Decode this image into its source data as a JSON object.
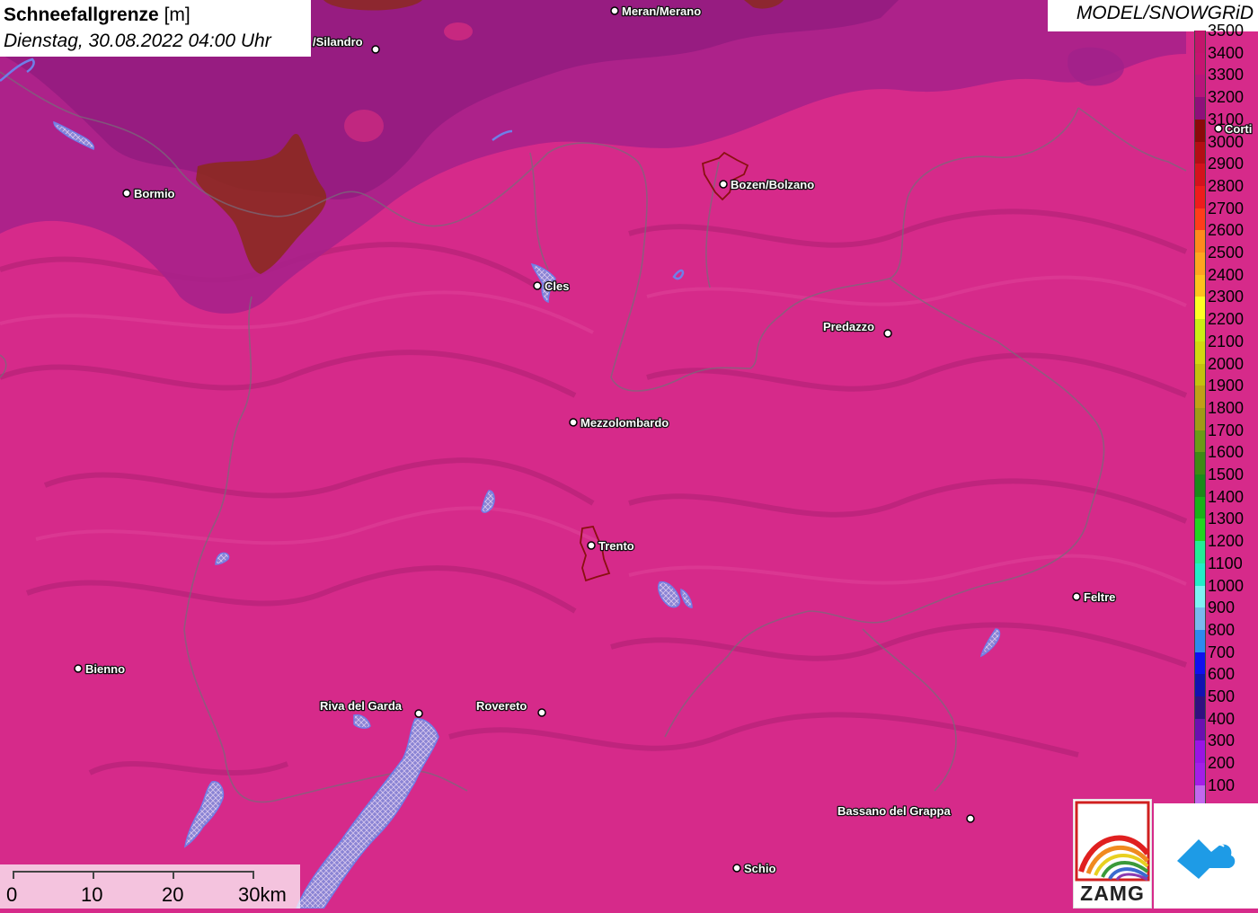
{
  "header": {
    "title_main": "Schneefallgrenze",
    "title_unit": "[m]",
    "datetime": "Dienstag, 30.08.2022 04:00 Uhr"
  },
  "model_label": "MODEL/SNOWGRiD",
  "colors": {
    "base_field": "#d62a8a",
    "lake_fill": "#8a84d4",
    "lake_outline": "#6f7fe8",
    "red_outline": "#8a1010",
    "border_line": "#7a6a7a"
  },
  "legend": [
    {
      "label": "3500",
      "color": "#c2156b"
    },
    {
      "label": "3400",
      "color": "#c51470"
    },
    {
      "label": "3300",
      "color": "#b8147a"
    },
    {
      "label": "3200",
      "color": "#8e0f7a"
    },
    {
      "label": "3100",
      "color": "#8b0a0a"
    },
    {
      "label": "3000",
      "color": "#b30e14"
    },
    {
      "label": "2900",
      "color": "#d4121c"
    },
    {
      "label": "2800",
      "color": "#ee1c1c"
    },
    {
      "label": "2700",
      "color": "#ff3d1a"
    },
    {
      "label": "2600",
      "color": "#ff8a1c"
    },
    {
      "label": "2500",
      "color": "#ffa51f"
    },
    {
      "label": "2400",
      "color": "#ffc21c"
    },
    {
      "label": "2300",
      "color": "#ffff24"
    },
    {
      "label": "2200",
      "color": "#ccee14"
    },
    {
      "label": "2100",
      "color": "#d2d810"
    },
    {
      "label": "2000",
      "color": "#c4c10e"
    },
    {
      "label": "1900",
      "color": "#c0a017"
    },
    {
      "label": "1800",
      "color": "#a09a16"
    },
    {
      "label": "1700",
      "color": "#6a9a16"
    },
    {
      "label": "1600",
      "color": "#3e8a14"
    },
    {
      "label": "1500",
      "color": "#1a8a1a"
    },
    {
      "label": "1400",
      "color": "#18b218"
    },
    {
      "label": "1300",
      "color": "#22d620"
    },
    {
      "label": "1200",
      "color": "#22ee96"
    },
    {
      "label": "1100",
      "color": "#22eec8"
    },
    {
      "label": "1000",
      "color": "#7ef2f4"
    },
    {
      "label": "900",
      "color": "#7ab8ee"
    },
    {
      "label": "800",
      "color": "#2e8aee"
    },
    {
      "label": "700",
      "color": "#1010ee"
    },
    {
      "label": "600",
      "color": "#1212b0"
    },
    {
      "label": "500",
      "color": "#301080"
    },
    {
      "label": "400",
      "color": "#6a10b0"
    },
    {
      "label": "300",
      "color": "#9a14e4"
    },
    {
      "label": "200",
      "color": "#a41ee8"
    },
    {
      "label": "100",
      "color": "#c268ee"
    }
  ],
  "cities": [
    {
      "name": "Meran/Merano"
    },
    {
      "name": "/Silandro"
    },
    {
      "name": "Bormio"
    },
    {
      "name": "Bozen/Bolzano"
    },
    {
      "name": "Cles"
    },
    {
      "name": "Predazzo"
    },
    {
      "name": "Mezzolombardo"
    },
    {
      "name": "Trento"
    },
    {
      "name": "Feltre"
    },
    {
      "name": "Bienno"
    },
    {
      "name": "Riva del Garda"
    },
    {
      "name": "Rovereto"
    },
    {
      "name": "Bassano del Grappa"
    },
    {
      "name": "Schio"
    },
    {
      "name": "Corti"
    }
  ],
  "scalebar": {
    "ticks": [
      "0",
      "10",
      "20",
      "30km"
    ]
  },
  "logos": {
    "zamg_text": "ZAMG",
    "zamg_icon": "zamg-rainbow-logo",
    "snowgrid_icon": "snowgrid-cloud-logo"
  }
}
